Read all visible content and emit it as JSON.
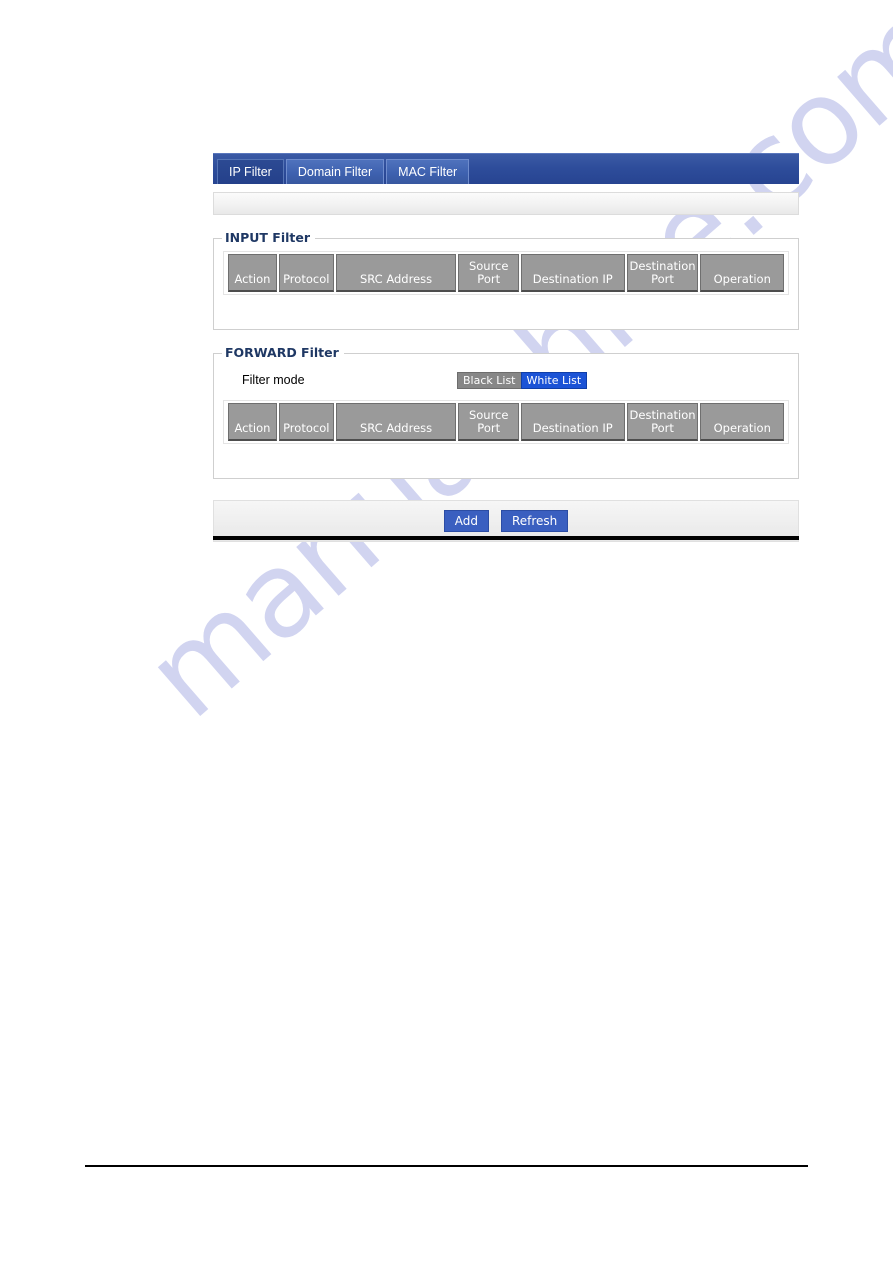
{
  "watermark": {
    "text": "manualshive.com"
  },
  "colors": {
    "tabbar_blue": "#2e4d9b",
    "active_tab_blue": "#24408a",
    "header_gray": "#9a9a9a",
    "button_blue": "#3a5fc0",
    "mode_active_blue": "#1b53d6",
    "mode_inactive_gray": "#878787",
    "legend_navy": "#1f3864"
  },
  "tabs": [
    {
      "label": "IP Filter",
      "active": true
    },
    {
      "label": "Domain Filter",
      "active": false
    },
    {
      "label": "MAC Filter",
      "active": false
    }
  ],
  "statusbar": {
    "text": ""
  },
  "columns": [
    "Action",
    "Protocol",
    "SRC Address",
    "Source\nPort",
    "Destination IP",
    "Destination\nPort",
    "Operation"
  ],
  "input_filter": {
    "legend": "INPUT Filter",
    "columns": [
      "Action",
      "Protocol",
      "SRC Address",
      "Source\nPort",
      "Destination IP",
      "Destination\nPort",
      "Operation"
    ],
    "rows": []
  },
  "forward_filter": {
    "legend": "FORWARD Filter",
    "filter_mode_label": "Filter mode",
    "filter_modes": [
      {
        "label": "Black List",
        "selected": false
      },
      {
        "label": "White List",
        "selected": true
      }
    ],
    "columns": [
      "Action",
      "Protocol",
      "SRC Address",
      "Source\nPort",
      "Destination IP",
      "Destination\nPort",
      "Operation"
    ],
    "rows": []
  },
  "actions": {
    "add_label": "Add",
    "refresh_label": "Refresh"
  }
}
